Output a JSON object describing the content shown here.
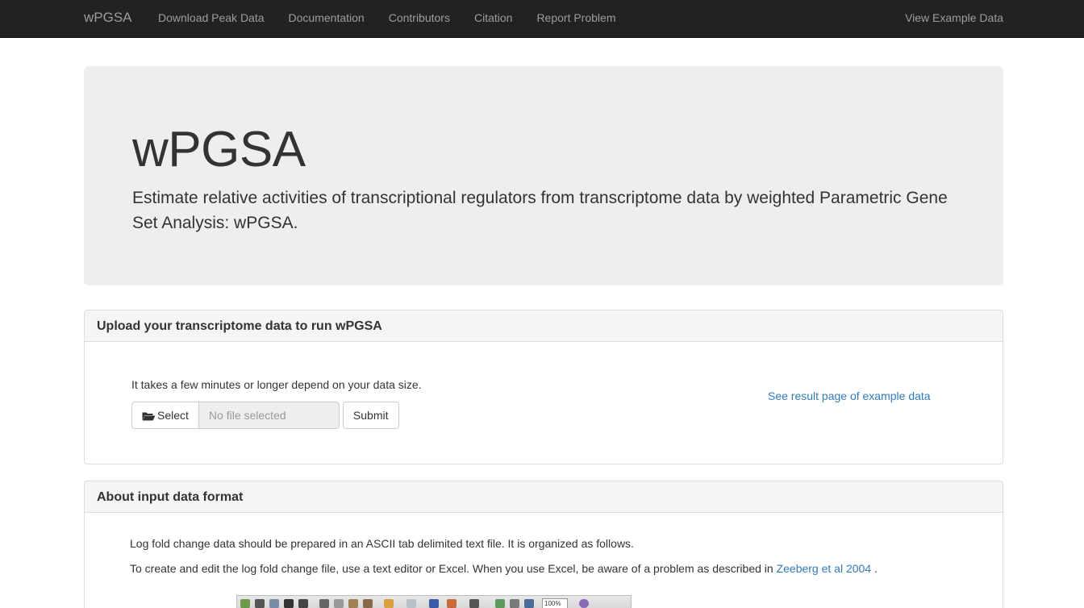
{
  "navbar": {
    "brand": "wPGSA",
    "links": [
      "Download Peak Data",
      "Documentation",
      "Contributors",
      "Citation",
      "Report Problem"
    ],
    "right_link": "View Example Data"
  },
  "jumbotron": {
    "title": "wPGSA",
    "lead": "Estimate relative activities of transcriptional regulators from transcriptome data by weighted Parametric Gene Set Analysis: wPGSA."
  },
  "upload_panel": {
    "heading": "Upload your transcriptome data to run wPGSA",
    "note": "It takes a few minutes or longer depend on your data size.",
    "select_label": "Select",
    "file_placeholder": "No file selected",
    "submit_label": "Submit",
    "example_link": "See result page of example data"
  },
  "format_panel": {
    "heading": "About input data format",
    "paragraph1": "Log fold change data should be prepared in an ASCII tab delimited text file. It is organized as follows.",
    "paragraph2_prefix": "To create and edit the log fold change file, use a text editor or Excel. When you use Excel, be aware of a problem as described in ",
    "paragraph2_link": "Zeeberg et al 2004",
    "paragraph2_suffix": " .",
    "toolbar_zoom": "100%"
  },
  "colors": {
    "navbar_bg": "#222222",
    "navbar_text": "#9d9d9d",
    "jumbotron_bg": "#eeeeee",
    "link": "#337ab7",
    "panel_heading_bg": "#f5f5f5"
  }
}
